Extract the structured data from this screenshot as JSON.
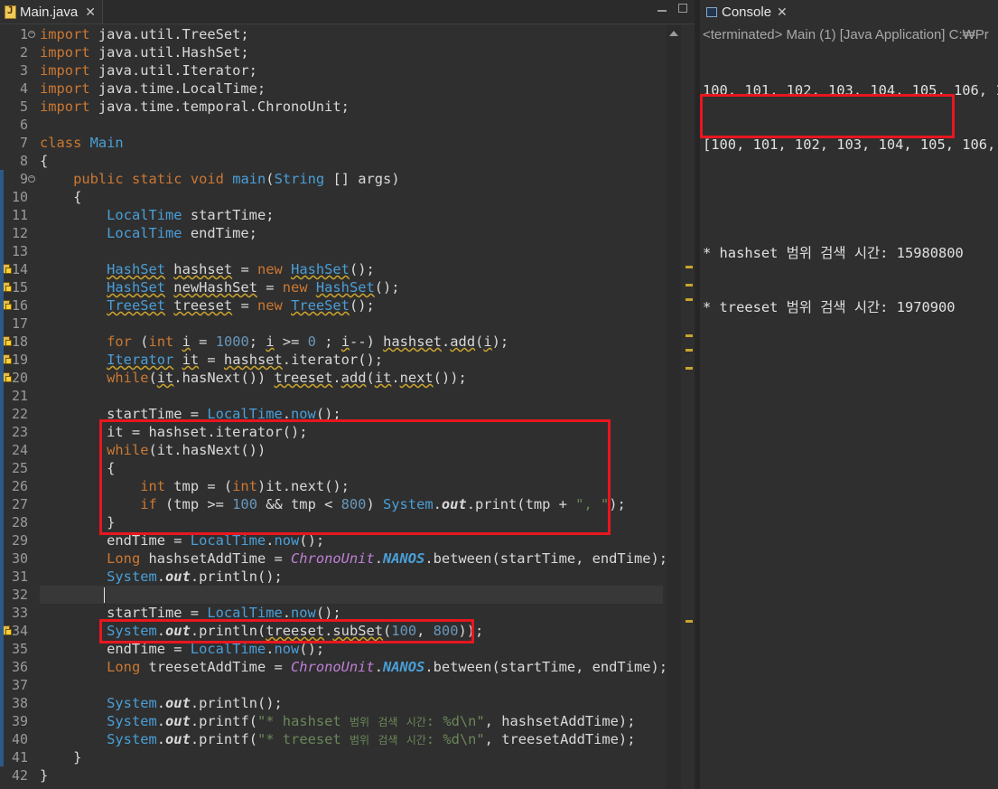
{
  "editor": {
    "tab_title": "Main.java",
    "close_glyph": "✕"
  },
  "console": {
    "tab_title": "Console",
    "close_glyph": "✕",
    "status": "<terminated> Main (1) [Java Application] C:₩Pr",
    "output": [
      "100, 101, 102, 103, 104, 105, 106, 10",
      "[100, 101, 102, 103, 104, 105, 106, 1",
      "",
      "* hashset 범위 검색 시간: 15980800",
      "* treeset 범위 검색 시간: 1970900"
    ]
  },
  "line_numbers": [
    "1",
    "2",
    "3",
    "4",
    "5",
    "6",
    "7",
    "8",
    "9",
    "10",
    "11",
    "12",
    "13",
    "14",
    "15",
    "16",
    "17",
    "18",
    "19",
    "20",
    "21",
    "22",
    "23",
    "24",
    "25",
    "26",
    "27",
    "28",
    "29",
    "30",
    "31",
    "32",
    "33",
    "34",
    "35",
    "36",
    "37",
    "38",
    "39",
    "40",
    "41",
    "42"
  ],
  "code_lines": [
    "import java.util.TreeSet;",
    "import java.util.HashSet;",
    "import java.util.Iterator;",
    "import java.time.LocalTime;",
    "import java.time.temporal.ChronoUnit;",
    "",
    "class Main",
    "{",
    "    public static void main(String [] args)",
    "    {",
    "        LocalTime startTime;",
    "        LocalTime endTime;",
    "",
    "        HashSet hashset = new HashSet();",
    "        HashSet newHashSet = new HashSet();",
    "        TreeSet treeset = new TreeSet();",
    "",
    "        for (int i = 1000; i >= 0 ; i--) hashset.add(i);",
    "        Iterator it = hashset.iterator();",
    "        while(it.hasNext()) treeset.add(it.next());",
    "",
    "        startTime = LocalTime.now();",
    "        it = hashset.iterator();",
    "        while(it.hasNext())",
    "        {",
    "            int tmp = (int)it.next();",
    "            if (tmp >= 100 && tmp < 800) System.out.print(tmp + \", \");",
    "        }",
    "        endTime = LocalTime.now();",
    "        Long hashsetAddTime = ChronoUnit.NANOS.between(startTime, endTime);",
    "        System.out.println();",
    "",
    "        startTime = LocalTime.now();",
    "        System.out.println(treeset.subSet(100, 800));",
    "        endTime = LocalTime.now();",
    "        Long treesetAddTime = ChronoUnit.NANOS.between(startTime, endTime);",
    "",
    "        System.out.println();",
    "        System.out.printf(\"* hashset 범위 검색 시간: %d\\n\", hashsetAddTime);",
    "        System.out.printf(\"* treeset 범위 검색 시간: %d\\n\", treesetAddTime);",
    "    }",
    "}"
  ],
  "warning_lines": [
    "14",
    "15",
    "16",
    "18",
    "19",
    "20",
    "34"
  ],
  "colors": {
    "keyword": "#cc7832",
    "type": "#4a9fd8",
    "string": "#6a8759",
    "number": "#6897bb",
    "highlight_box": "#e8161f"
  }
}
